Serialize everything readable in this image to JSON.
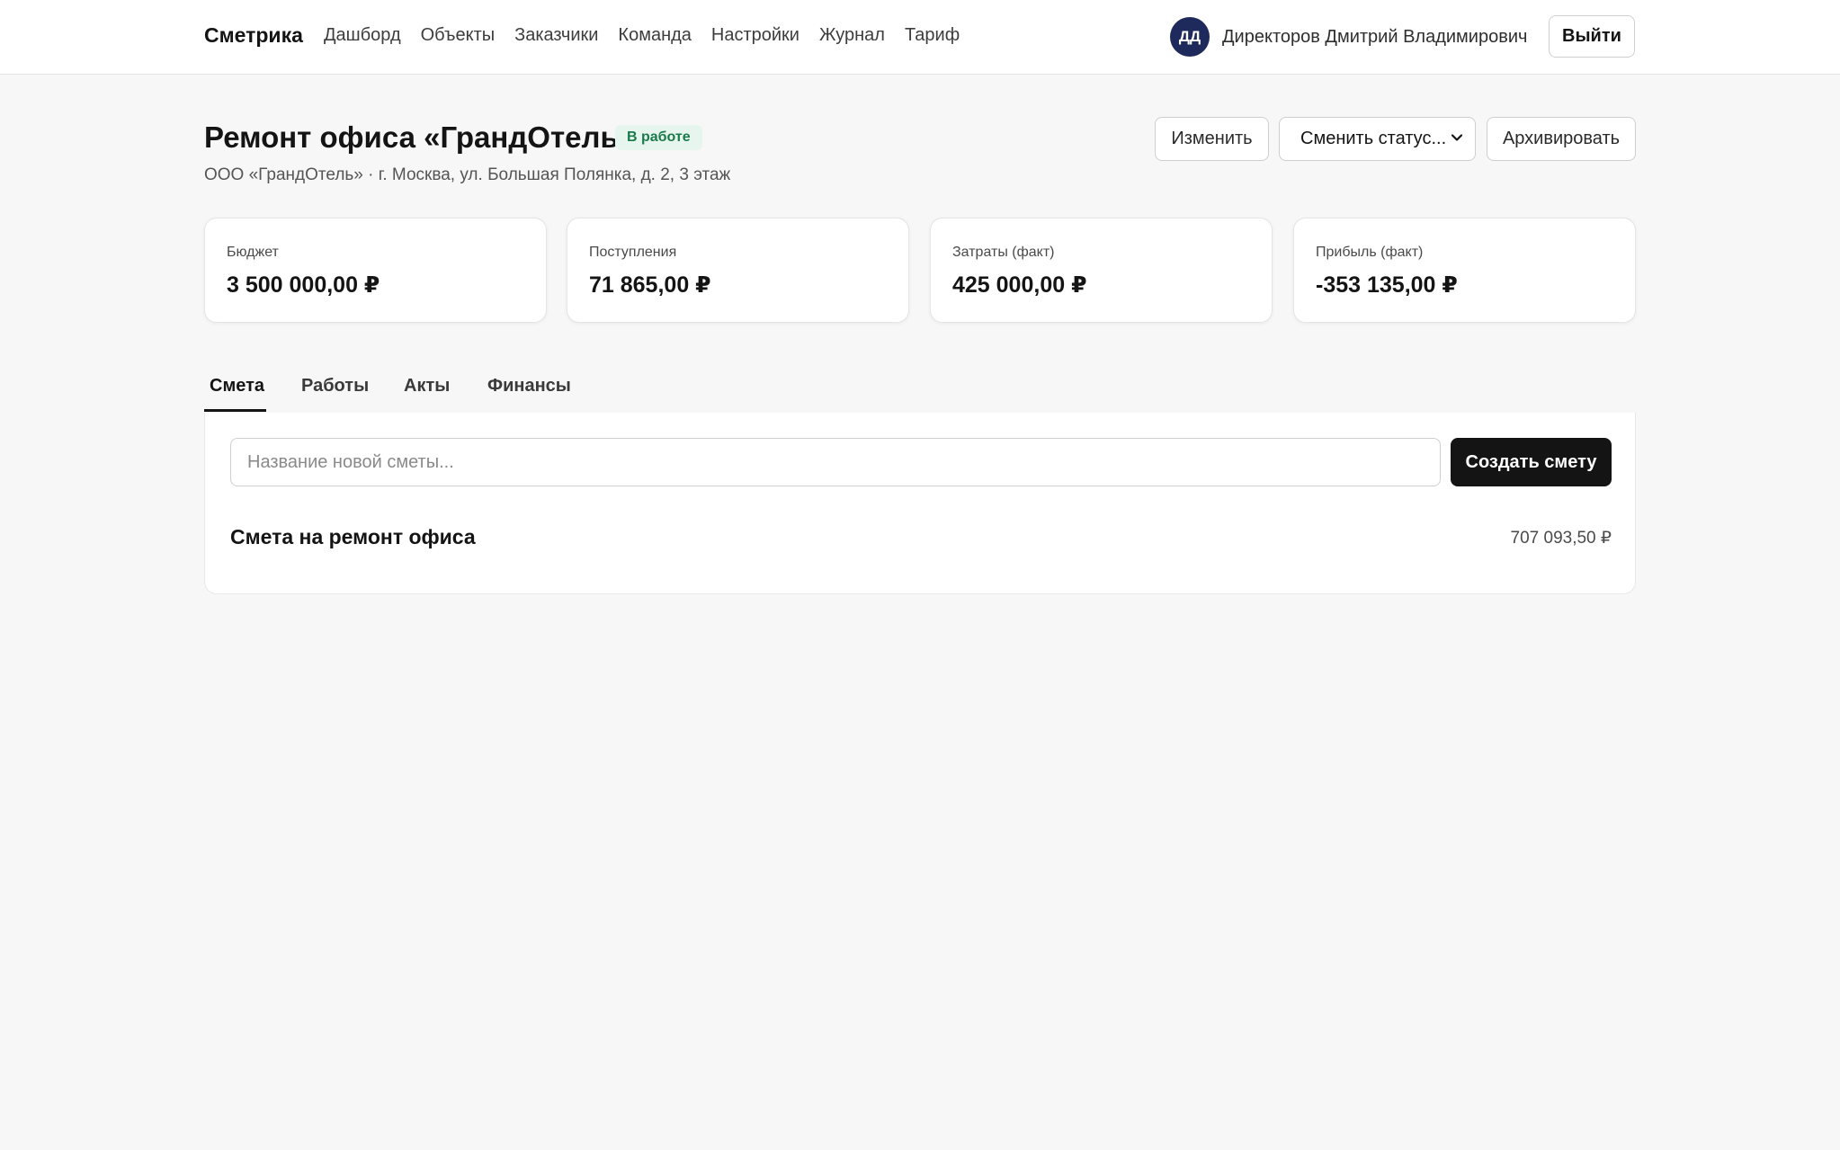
{
  "topbar": {
    "brand": "Сметрика",
    "nav": [
      "Дашборд",
      "Объекты",
      "Заказчики",
      "Команда",
      "Настройки",
      "Журнал",
      "Тариф"
    ],
    "user": {
      "initials": "ДД",
      "name": "Директоров Дмитрий Владимирович"
    },
    "logout_label": "Выйти"
  },
  "header": {
    "title": "Ремонт офиса «ГрандОтель»",
    "status": "В работе",
    "subtitle": "ООО «ГрандОтель» · г. Москва, ул. Большая Полянка, д. 2, 3 этаж",
    "edit_label": "Изменить",
    "status_select_label": "Сменить статус...",
    "archive_label": "Архивировать"
  },
  "stats": [
    {
      "label": "Бюджет",
      "value": "3 500 000,00 ₽"
    },
    {
      "label": "Поступления",
      "value": "71 865,00 ₽"
    },
    {
      "label": "Затраты (факт)",
      "value": "425 000,00 ₽"
    },
    {
      "label": "Прибыль (факт)",
      "value": "-353 135,00 ₽"
    }
  ],
  "tabs": [
    "Смета",
    "Работы",
    "Акты",
    "Финансы"
  ],
  "active_tab": "Смета",
  "estimates": {
    "input_placeholder": "Название новой сметы...",
    "input_value": "",
    "create_label": "Создать смету",
    "items": [
      {
        "name": "Смета на ремонт офиса",
        "total": "707 093,50 ₽"
      }
    ]
  },
  "colors": {
    "accent": "#141414",
    "avatar_bg": "#1f2a5c",
    "status_bg": "#e6f6ee",
    "status_text": "#1a7a4a",
    "page_bg": "#f7f7f7"
  },
  "icons": {
    "status_select": "chevron-down-icon"
  }
}
